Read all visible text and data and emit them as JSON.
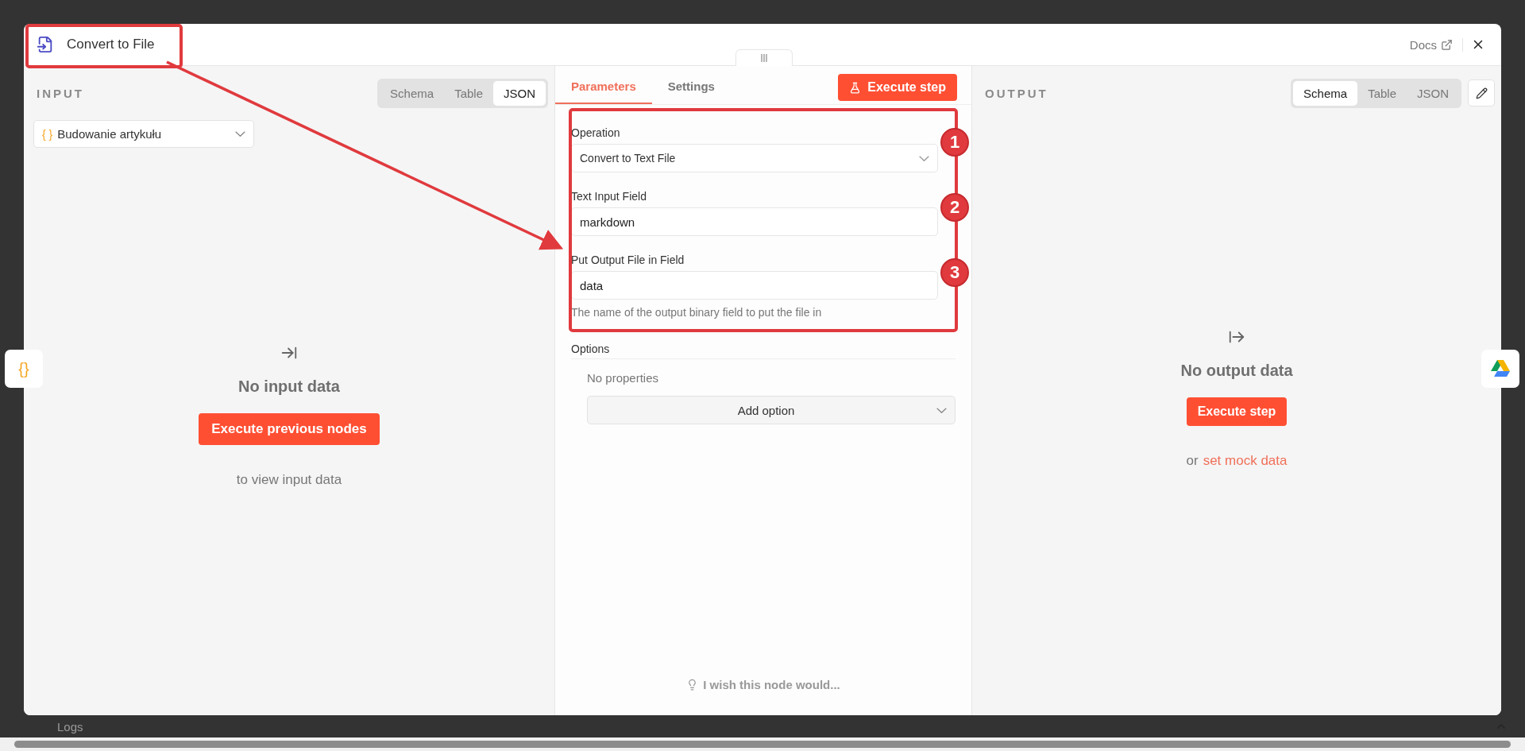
{
  "modal": {
    "title": "Convert to File",
    "docs_link": "Docs"
  },
  "input_panel": {
    "heading": "INPUT",
    "view_tabs": [
      {
        "label": "Schema",
        "selected": false
      },
      {
        "label": "Table",
        "selected": false
      },
      {
        "label": "JSON",
        "selected": true
      }
    ],
    "source_select": {
      "icon_text": "{ }",
      "value": "Budowanie artykułu"
    },
    "empty_title": "No input data",
    "action": "Execute previous nodes",
    "hint": "to view input data"
  },
  "parameters_panel": {
    "tabs": [
      {
        "label": "Parameters",
        "selected": true
      },
      {
        "label": "Settings",
        "selected": false
      }
    ],
    "execute_button": "Execute step",
    "fields": [
      {
        "kind": "select",
        "label": "Operation",
        "value": "Convert to Text File"
      },
      {
        "kind": "text",
        "label": "Text Input Field",
        "value": "markdown"
      },
      {
        "kind": "text",
        "label": "Put Output File in Field",
        "value": "data",
        "hint": "The name of the output binary field to put the file in"
      }
    ],
    "options": {
      "heading": "Options",
      "empty": "No properties",
      "add_button": "Add option"
    },
    "feedback": "I wish this node would..."
  },
  "output_panel": {
    "heading": "OUTPUT",
    "view_tabs": [
      {
        "label": "Schema",
        "selected": true
      },
      {
        "label": "Table",
        "selected": false
      },
      {
        "label": "JSON",
        "selected": false
      }
    ],
    "empty_title": "No output data",
    "action": "Execute step",
    "hint_prefix": "or",
    "hint_link": "set mock data"
  },
  "floating_left": {
    "icon_text": "{}"
  },
  "annotations": [
    {
      "label": "1"
    },
    {
      "label": "2"
    },
    {
      "label": "3"
    }
  ],
  "bottom_bar": {
    "logs": "Logs"
  }
}
